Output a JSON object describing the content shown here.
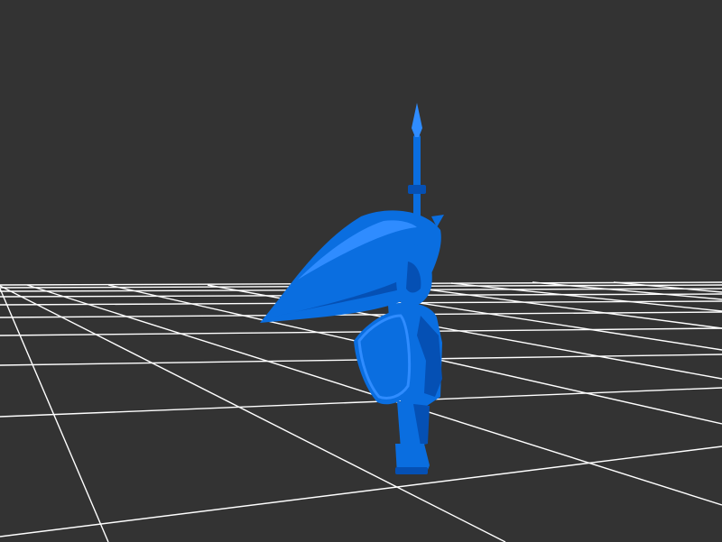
{
  "scene": {
    "background_color": "#333333",
    "grid_color": "#ffffff",
    "model_color": "#0a6ee0",
    "model_shade_color": "#0550b4",
    "model_highlight_color": "#2f8cff",
    "model_name": "",
    "grid_visible": true
  }
}
